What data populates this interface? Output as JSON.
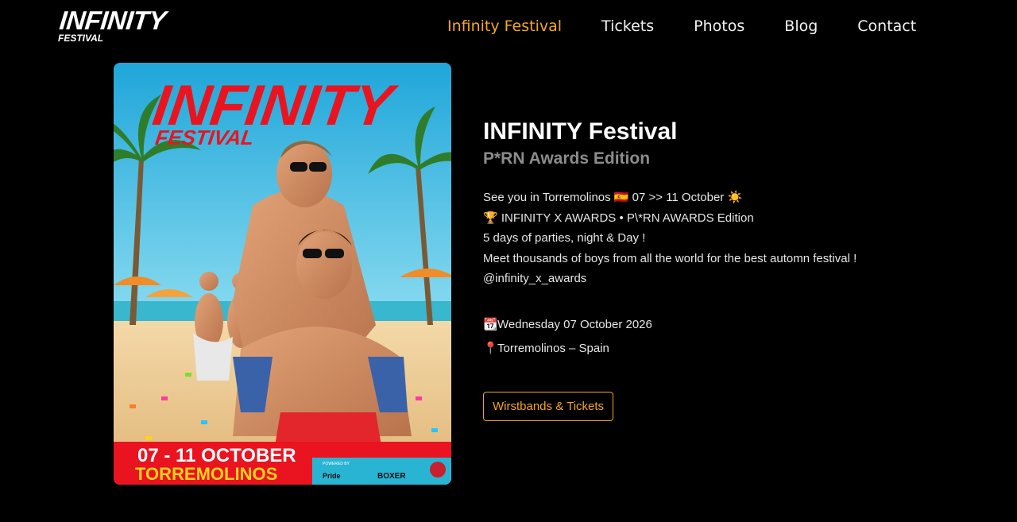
{
  "header": {
    "logo_main": "INFINITY",
    "logo_sub": "FESTIVAL",
    "nav": [
      {
        "label": "Infinity Festival",
        "active": true
      },
      {
        "label": "Tickets"
      },
      {
        "label": "Photos"
      },
      {
        "label": "Blog"
      },
      {
        "label": "Contact"
      }
    ]
  },
  "poster": {
    "headline": "INFINITY",
    "headline_sub": "FESTIVAL",
    "dates": "07 - 11 OCTOBER",
    "city": "TORREMOLINOS",
    "powered_by": "POWERED BY",
    "sponsor_1": "Pride",
    "sponsor_2": "BOXER"
  },
  "event": {
    "title": "INFINITY Festival",
    "subtitle": "P*RN Awards Edition",
    "desc_lines": [
      "See you in Torremolinos 🇪🇸 07 >> 11 October ☀️",
      "🏆 INFINITY X AWARDS • P\\*RN AWARDS Edition",
      "5 days of parties, night & Day !",
      "Meet thousands of boys from all the world for the best automn festival !",
      "@infinity_x_awards"
    ],
    "date_icon": "📆",
    "date": "Wednesday 07 October 2026",
    "location_icon": "📍",
    "location": "Torremolinos – Spain",
    "cta_label": "Wirstbands & Tickets"
  },
  "colors": {
    "accent": "#f5a623",
    "background": "#000000",
    "subtitle": "#8c8c8c"
  }
}
